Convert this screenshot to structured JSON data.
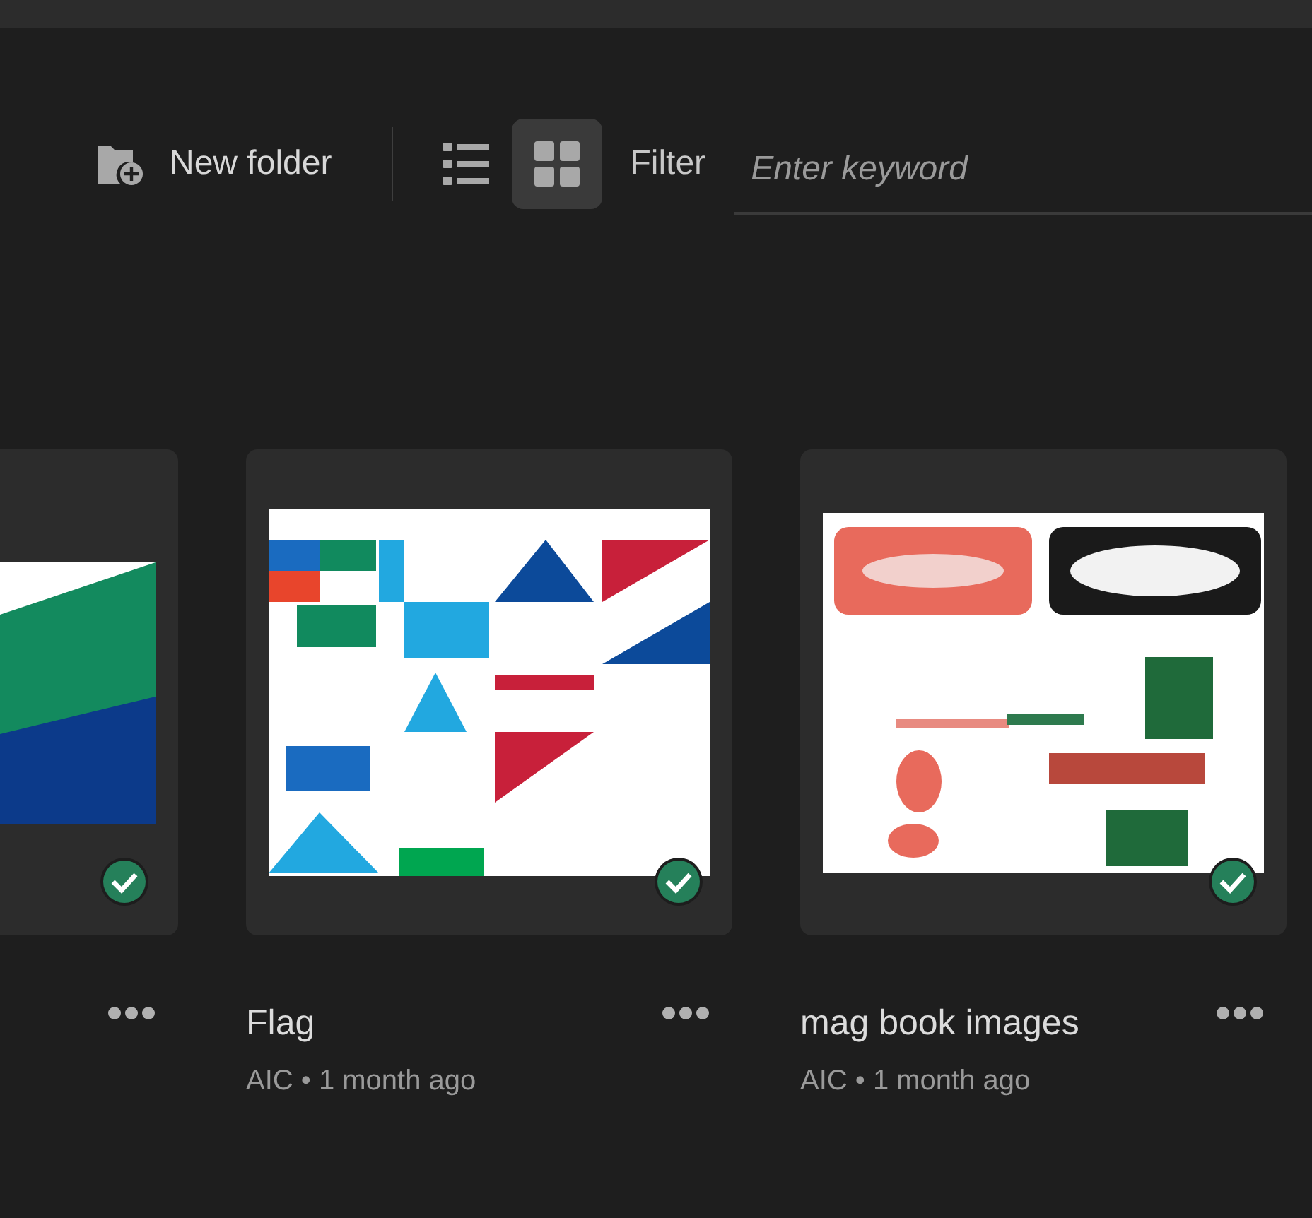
{
  "toolbar": {
    "new_folder": "New folder",
    "views": [
      {
        "kind": "list",
        "selected": false
      },
      {
        "kind": "grid",
        "selected": true
      }
    ],
    "filter_label": "Filter",
    "filter": {
      "placeholder": "Enter keyword"
    }
  },
  "cards": [
    {
      "synced": true
    },
    {
      "synced": true,
      "title": "Flag",
      "meta": "AIC • 1 month ago"
    },
    {
      "synced": true,
      "title": "mag book images",
      "meta": "AIC • 1 month ago"
    }
  ]
}
